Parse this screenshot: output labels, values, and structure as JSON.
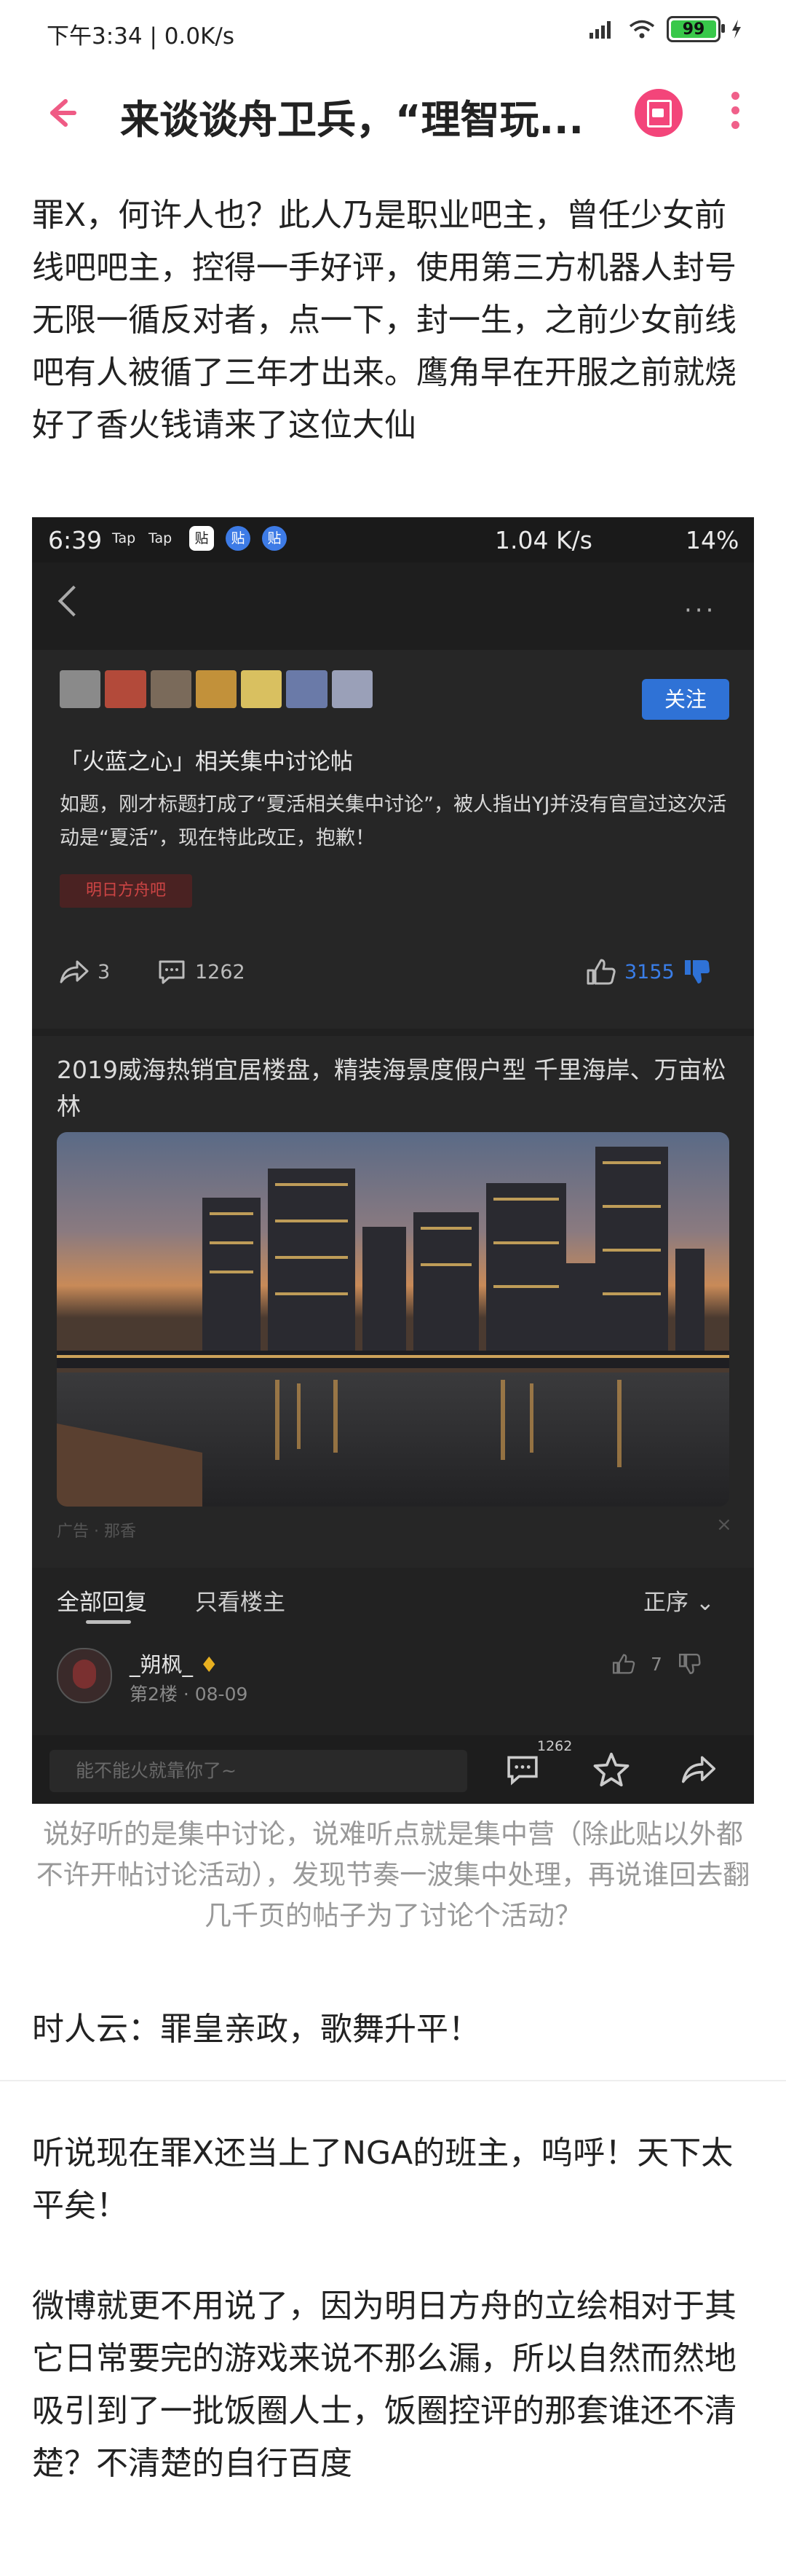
{
  "status_bar": {
    "time": "下午3:34 | 0.0K/s",
    "battery": "99"
  },
  "header": {
    "title": "来谈谈舟卫兵，“理智玩..."
  },
  "article": {
    "para1": "罪X，何许人也？此人乃是职业吧主，曾任少女前线吧吧主，控得一手好评，使用第三方机器人封号无限一循反对者，点一下，封一生，之前少女前线吧有人被循了三年才出来。鹰角早在开服之前就烧好了香火钱请来了这位大仙",
    "caption": "说好听的是集中讨论，说难听点就是集中营（除此贴以外都不许开帖讨论活动），发现节奏一波集中处理，再说谁回去翻几千页的帖子为了讨论个活动？",
    "para2": "时人云：罪皇亲政，歌舞升平！",
    "para3": "听说现在罪X还当上了NGA的班主，呜呼！天下太平矣！",
    "para4": "微博就更不用说了，因为明日方舟的立绘相对于其它日常要完的游戏来说不那么漏，所以自然而然地吸引到了一批饭圈人士，饭圈控评的那套谁还不清楚？不清楚的自行百度"
  },
  "embedded": {
    "status": {
      "time": "6:39",
      "mini1": "Tap",
      "mini2": "Tap",
      "app1": "贴",
      "app2": "贴",
      "app3": "贴",
      "net": "1.04 K/s",
      "battery": "14%"
    },
    "post": {
      "follow": "关注",
      "title": "「火蓝之心」相关集中讨论帖",
      "body": "如题，刚才标题打成了“夏活相关集中讨论”，被人指出YJ并没有官宣过这次活动是“夏活”，现在特此改正，抱歉！",
      "tag": "明日方舟吧",
      "shares": "3",
      "comments": "1262",
      "likes": "3155"
    },
    "ad": {
      "title": "2019威海热销宜居楼盘，精装海景度假户型 千里海岸、万亩松林",
      "footer": "广告 · 那香",
      "close": "×"
    },
    "tabs": {
      "all": "全部回复",
      "owner": "只看楼主",
      "sort": "正序"
    },
    "reply": {
      "user": "_朔枫_",
      "floor": "第2楼 · 08-09",
      "likes": "7"
    },
    "bottom": {
      "placeholder": "能不能火就靠你了~",
      "count": "1262"
    }
  },
  "colors": {
    "accent": "#f0608a",
    "blue": "#2f72d6"
  }
}
